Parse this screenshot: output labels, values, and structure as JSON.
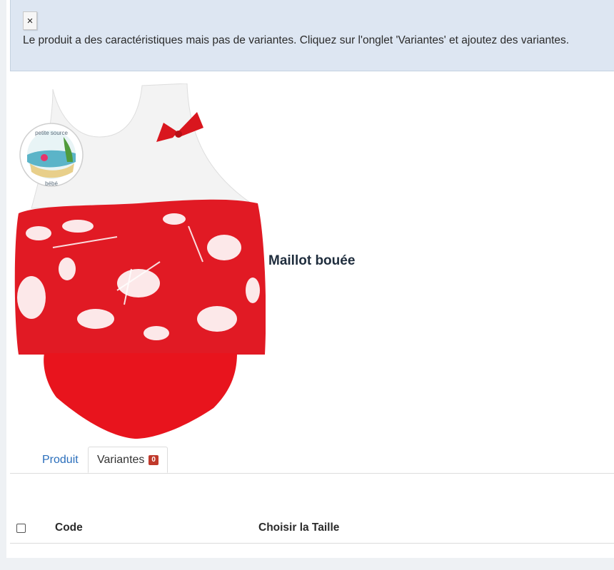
{
  "alert": {
    "close_label": "×",
    "message": "Le produit a des caractéristiques mais pas de variantes. Cliquez sur l'onglet 'Variantes' et ajoutez des variantes."
  },
  "product": {
    "title": "Maillot bouée",
    "logo_text_top": "petite source",
    "logo_text_bottom": "bébé"
  },
  "tabs": [
    {
      "label": "Produit"
    },
    {
      "label": "Variantes",
      "badge": "0"
    }
  ],
  "table": {
    "columns": [
      "Code",
      "Choisir la Taille"
    ]
  },
  "colors": {
    "accent": "#2a6ebb",
    "badge": "#c0392b",
    "alert_bg": "#dde6f2"
  }
}
